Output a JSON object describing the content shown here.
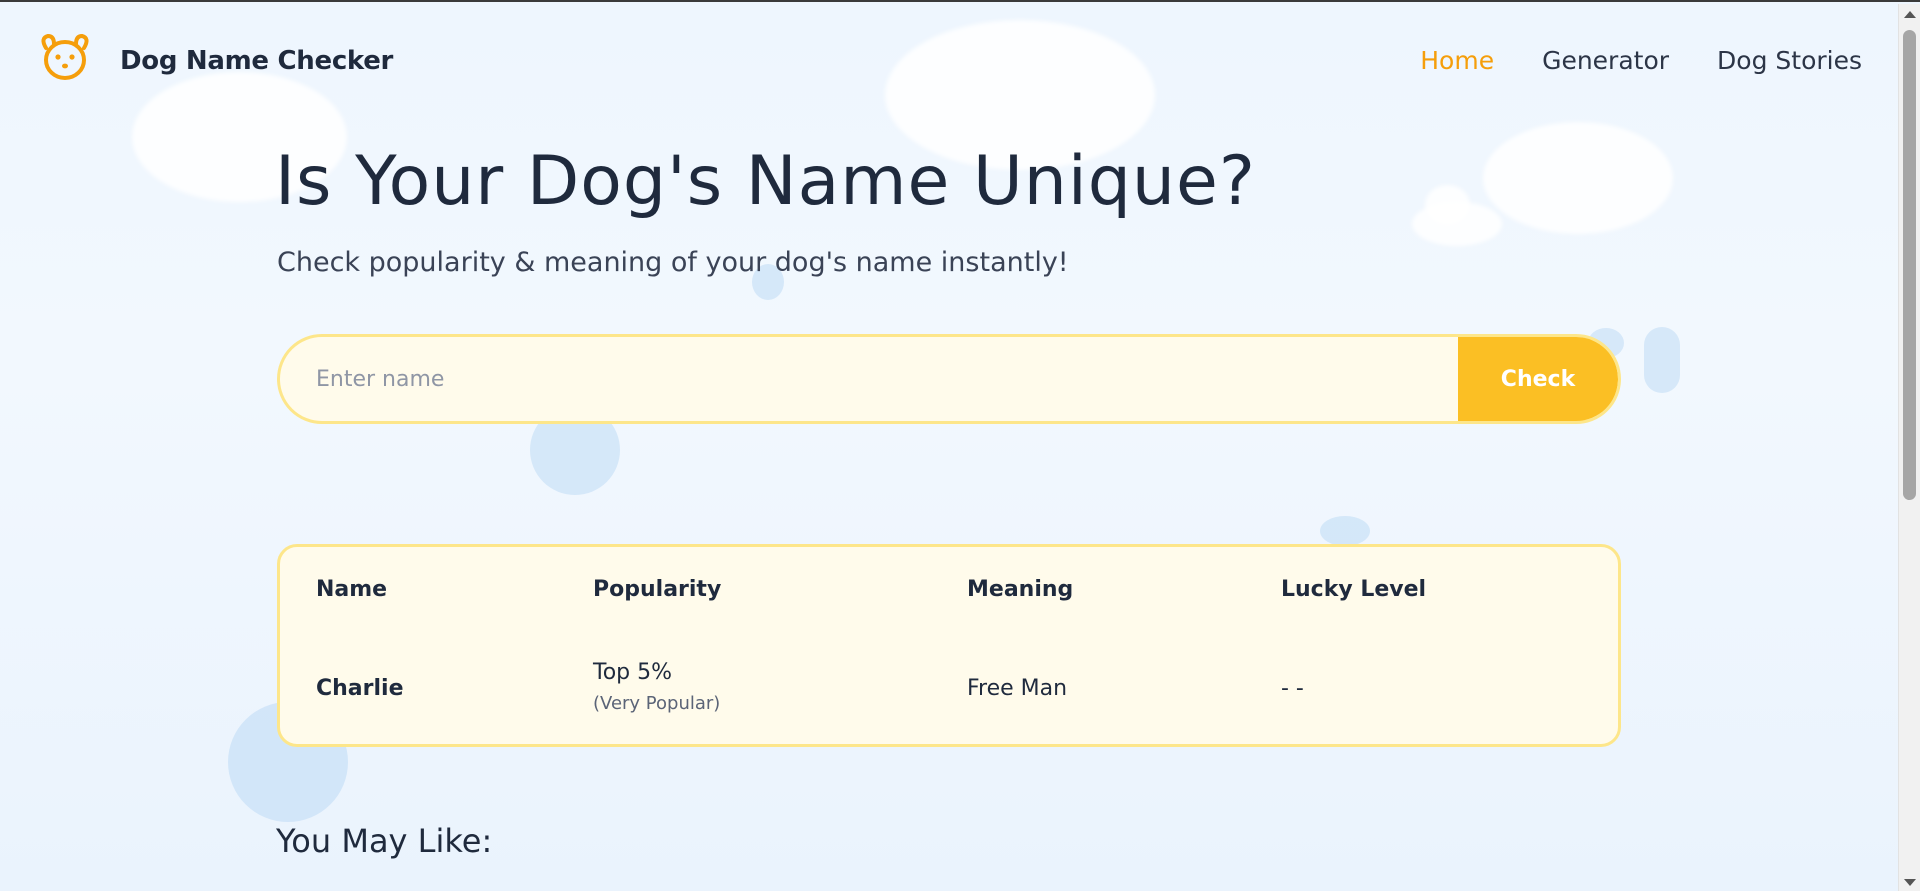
{
  "header": {
    "brand": "Dog Name Checker",
    "logo_icon": "dog-face-icon",
    "nav": [
      {
        "label": "Home",
        "active": true
      },
      {
        "label": "Generator",
        "active": false
      },
      {
        "label": "Dog Stories",
        "active": false
      }
    ]
  },
  "hero": {
    "title": "Is Your Dog's Name Unique?",
    "subtitle": "Check popularity & meaning of your dog's name instantly!"
  },
  "search": {
    "placeholder": "Enter name",
    "value": "",
    "button_label": "Check"
  },
  "result": {
    "headers": [
      "Name",
      "Popularity",
      "Meaning",
      "Lucky Level"
    ],
    "row": {
      "name": "Charlie",
      "popularity": "Top 5%",
      "popularity_note": "(Very Popular)",
      "meaning": "Free Man",
      "lucky_level": "- -"
    }
  },
  "recommendations": {
    "title": "You May Like:"
  },
  "colors": {
    "accent": "#f59e0b",
    "button": "#fbbf24",
    "card_bg": "#fffbeb",
    "card_border": "#fde68a",
    "text": "#1f2a3d"
  }
}
